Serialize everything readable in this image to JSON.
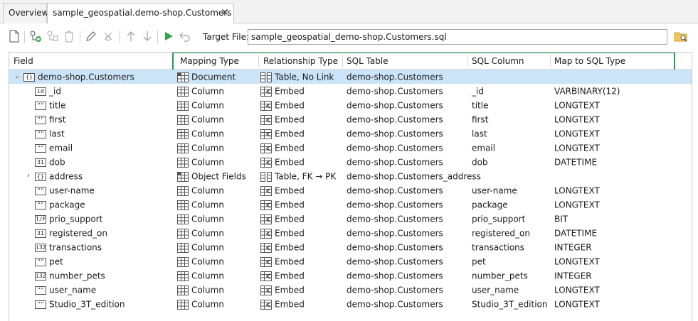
{
  "tabs": [
    {
      "label": "Overview"
    },
    {
      "label": "sample_geospatial.demo-shop.Customers",
      "close": "✕"
    }
  ],
  "toolbar": {
    "target_label": "Target File:",
    "target_value": "sample_geospatial_demo-shop.Customers.sql"
  },
  "columns": [
    "Field",
    "Mapping Type",
    "Relationship Type",
    "SQL Table",
    "SQL Column",
    "Map to SQL Type"
  ],
  "accent_color": "#1f9d55",
  "rows": [
    {
      "field": "demo-shop.Customers",
      "ftype": "{}",
      "mapping": "Document",
      "relationship": "Table, No Link",
      "table": "demo-shop.Customers",
      "column": "",
      "sqltype": ""
    },
    {
      "field": "_id",
      "ftype": "id",
      "mapping": "Column",
      "relationship": "Embed",
      "table": "demo-shop.Customers",
      "column": "_id",
      "sqltype": "VARBINARY(12)"
    },
    {
      "field": "title",
      "ftype": "\"\"",
      "mapping": "Column",
      "relationship": "Embed",
      "table": "demo-shop.Customers",
      "column": "title",
      "sqltype": "LONGTEXT"
    },
    {
      "field": "first",
      "ftype": "\"\"",
      "mapping": "Column",
      "relationship": "Embed",
      "table": "demo-shop.Customers",
      "column": "first",
      "sqltype": "LONGTEXT"
    },
    {
      "field": "last",
      "ftype": "\"\"",
      "mapping": "Column",
      "relationship": "Embed",
      "table": "demo-shop.Customers",
      "column": "last",
      "sqltype": "LONGTEXT"
    },
    {
      "field": "email",
      "ftype": "\"\"",
      "mapping": "Column",
      "relationship": "Embed",
      "table": "demo-shop.Customers",
      "column": "email",
      "sqltype": "LONGTEXT"
    },
    {
      "field": "dob",
      "ftype": "31",
      "mapping": "Column",
      "relationship": "Embed",
      "table": "demo-shop.Customers",
      "column": "dob",
      "sqltype": "DATETIME"
    },
    {
      "field": "address",
      "ftype": "{}",
      "mapping": "Object Fields",
      "relationship": "Table, FK → PK",
      "table": "demo-shop.Customers_address",
      "column": "",
      "sqltype": ""
    },
    {
      "field": "user-name",
      "ftype": "\"\"",
      "mapping": "Column",
      "relationship": "Embed",
      "table": "demo-shop.Customers",
      "column": "user-name",
      "sqltype": "LONGTEXT"
    },
    {
      "field": "package",
      "ftype": "\"\"",
      "mapping": "Column",
      "relationship": "Embed",
      "table": "demo-shop.Customers",
      "column": "package",
      "sqltype": "LONGTEXT"
    },
    {
      "field": "prio_support",
      "ftype": "T/F",
      "mapping": "Column",
      "relationship": "Embed",
      "table": "demo-shop.Customers",
      "column": "prio_support",
      "sqltype": "BIT"
    },
    {
      "field": "registered_on",
      "ftype": "31",
      "mapping": "Column",
      "relationship": "Embed",
      "table": "demo-shop.Customers",
      "column": "registered_on",
      "sqltype": "DATETIME"
    },
    {
      "field": "transactions",
      "ftype": "i32",
      "mapping": "Column",
      "relationship": "Embed",
      "table": "demo-shop.Customers",
      "column": "transactions",
      "sqltype": "INTEGER"
    },
    {
      "field": "pet",
      "ftype": "\"\"",
      "mapping": "Column",
      "relationship": "Embed",
      "table": "demo-shop.Customers",
      "column": "pet",
      "sqltype": "LONGTEXT"
    },
    {
      "field": "number_pets",
      "ftype": "i32",
      "mapping": "Column",
      "relationship": "Embed",
      "table": "demo-shop.Customers",
      "column": "number_pets",
      "sqltype": "INTEGER"
    },
    {
      "field": "user_name",
      "ftype": "\"\"",
      "mapping": "Column",
      "relationship": "Embed",
      "table": "demo-shop.Customers",
      "column": "user_name",
      "sqltype": "LONGTEXT"
    },
    {
      "field": "Studio_3T_edition",
      "ftype": "\"\"",
      "mapping": "Column",
      "relationship": "Embed",
      "table": "demo-shop.Customers",
      "column": "Studio_3T_edition",
      "sqltype": "LONGTEXT"
    }
  ]
}
